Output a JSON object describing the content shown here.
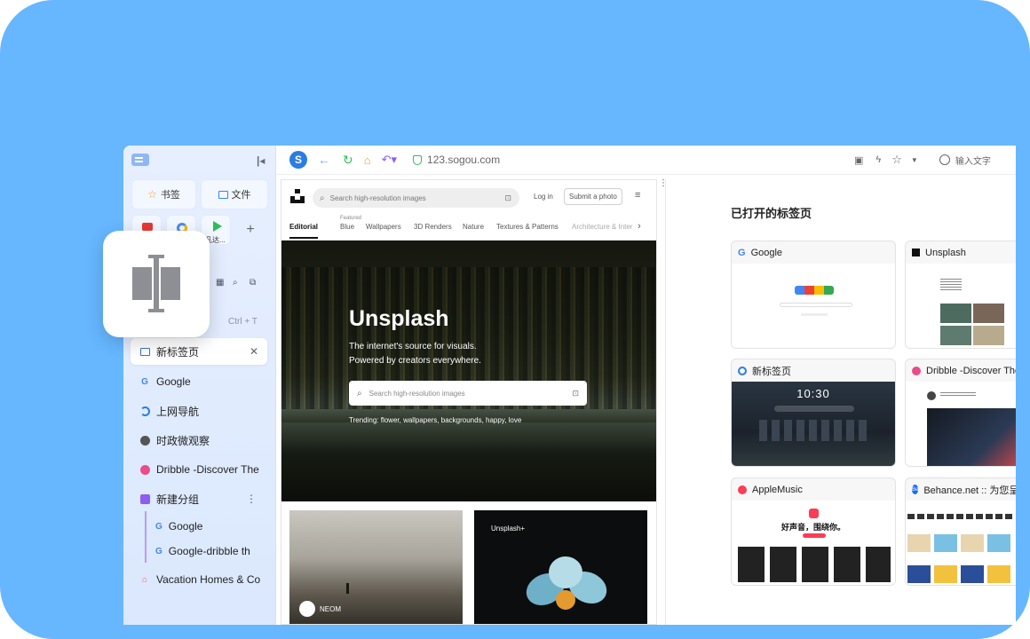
{
  "sidebar": {
    "quick": {
      "bookmarks": "书签",
      "files": "文件"
    },
    "apps": [
      {
        "label": ""
      },
      {
        "label": ""
      },
      {
        "label": "阿凡达..."
      }
    ],
    "new_tab_shortcut": "Ctrl + T",
    "tabs": [
      {
        "label": "新标签页",
        "icon": "new-tab-icon"
      },
      {
        "label": "Google",
        "icon": "google-icon"
      },
      {
        "label": "上网导航",
        "icon": "sogou-icon"
      },
      {
        "label": "时政微观察",
        "icon": "globe-icon"
      },
      {
        "label": "Dribble -Discover The",
        "icon": "dribbble-icon"
      },
      {
        "label": "新建分组",
        "icon": "group-icon"
      }
    ],
    "group_tabs": [
      {
        "label": "Google",
        "icon": "google-icon"
      },
      {
        "label": "Google-dribble th",
        "icon": "google-icon"
      }
    ],
    "last_tab": {
      "label": "Vacation Homes & Co",
      "icon": "airbnb-icon"
    }
  },
  "toolbar": {
    "url": "123.sogou.com",
    "search_placeholder": "输入文字"
  },
  "unsplash": {
    "search_placeholder": "Search high-resolution images",
    "login": "Log in",
    "submit": "Submit a photo",
    "tabs": [
      "Editorial",
      "Blue",
      "Wallpapers",
      "3D Renders",
      "Nature",
      "Textures & Patterns",
      "Architecture & Inter"
    ],
    "featured_label": "Featured",
    "hero_title": "Unsplash",
    "hero_line1": "The internet's source for visuals.",
    "hero_line2": "Powered by creators everywhere.",
    "hero_search": "Search high-resolution images",
    "trending": "Trending: flower, wallpapers, backgrounds, happy, love",
    "card1_label": "NEOM",
    "card2_label": "Unsplash+"
  },
  "open_tabs": {
    "title": "已打开的标签页",
    "cards": [
      {
        "title": "Google"
      },
      {
        "title": "Unsplash"
      },
      {
        "title": "新标签页",
        "time": "10:30"
      },
      {
        "title": "Dribble -Discover The"
      },
      {
        "title": "AppleMusic",
        "tagline": "好声音，围绕你。"
      },
      {
        "title": "Behance.net :: 为您呈现"
      }
    ]
  },
  "colors": {
    "background": "#66b7ff",
    "accent": "#4a8df0"
  }
}
